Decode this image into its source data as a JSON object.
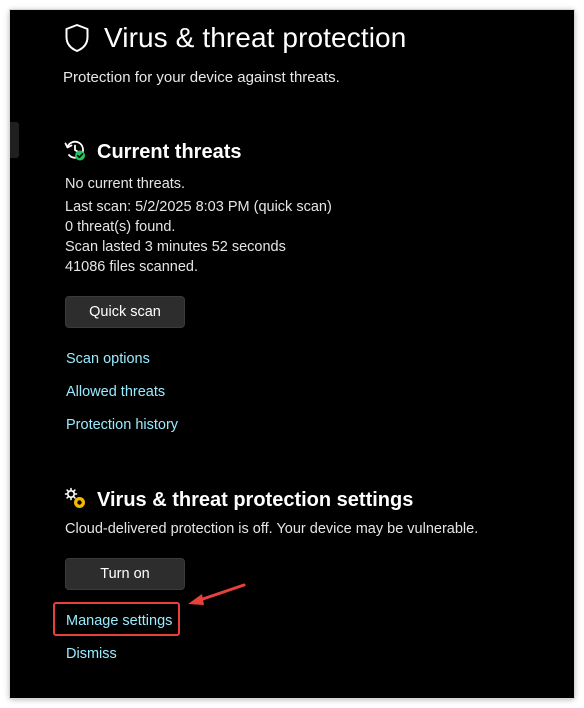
{
  "colors": {
    "background": "#000000",
    "text": "#ffffff",
    "link": "#99ebff",
    "button_bg": "#2d2d2d",
    "highlight": "#e8413c",
    "status_ok": "#22c55e"
  },
  "header": {
    "icon": "shield-icon",
    "title": "Virus & threat protection",
    "subtitle": "Protection for your device against threats."
  },
  "current_threats": {
    "icon": "history-check-icon",
    "title": "Current threats",
    "lines": [
      "No current threats.",
      "Last scan: 5/2/2025 8:03 PM (quick scan)",
      "0 threat(s) found.",
      "Scan lasted 3 minutes 52 seconds",
      "41086 files scanned."
    ],
    "quick_scan_label": "Quick scan",
    "links": [
      "Scan options",
      "Allowed threats",
      "Protection history"
    ]
  },
  "protection_settings": {
    "icon": "settings-gears-icon",
    "title": "Virus & threat protection settings",
    "status": "Cloud-delivered protection is off. Your device may be vulnerable.",
    "turn_on_label": "Turn on",
    "manage_settings_label": "Manage settings",
    "dismiss_label": "Dismiss"
  },
  "annotation": {
    "highlighted_element": "manage-settings-link",
    "arrow_icon": "red-arrow-icon"
  }
}
